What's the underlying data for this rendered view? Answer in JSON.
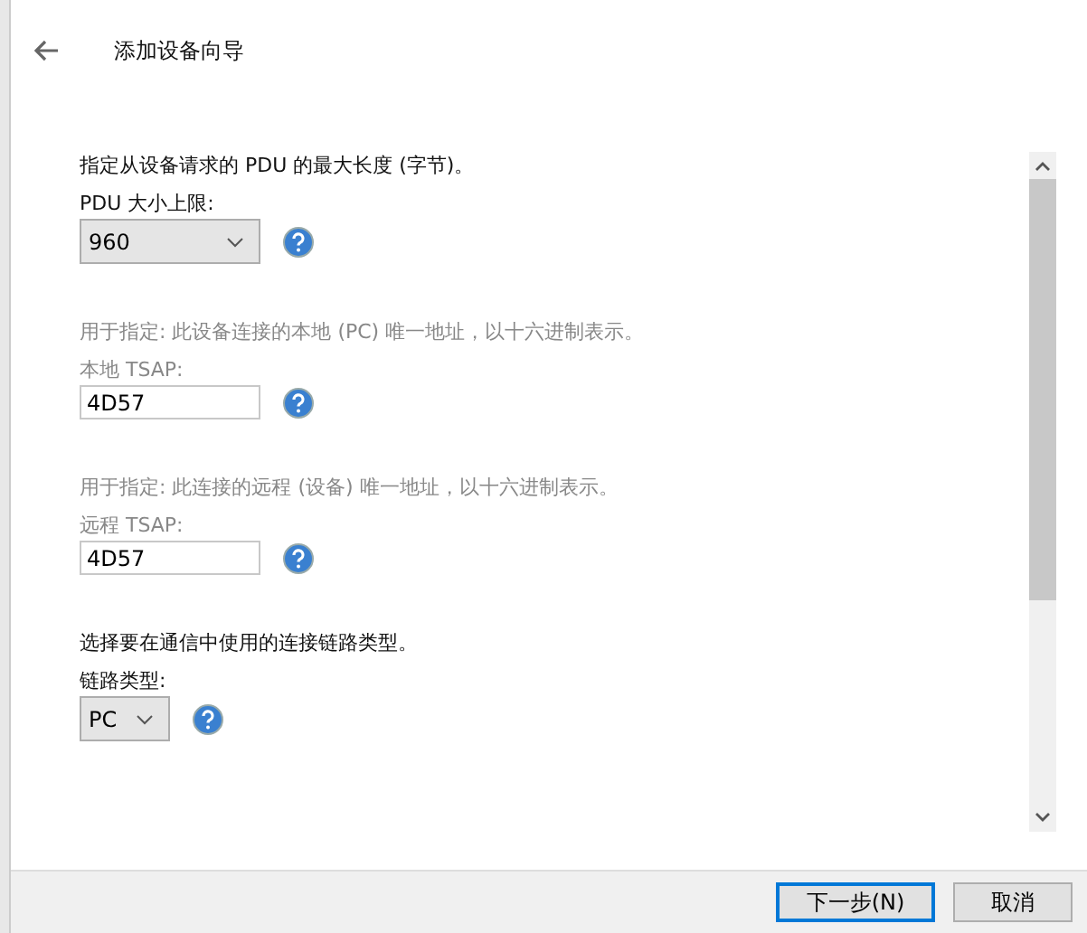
{
  "window": {
    "title": "添加设备向导"
  },
  "sections": [
    {
      "kind": "select",
      "disabled": false,
      "description": "指定从设备请求的  PDU 的最大长度 (字节)。",
      "label": "PDU 大小上限:",
      "value": "960",
      "narrow": false
    },
    {
      "kind": "input",
      "disabled": true,
      "description": "用于指定: 此设备连接的本地 (PC) 唯一地址，以十六进制表示。",
      "label": "本地 TSAP:",
      "value": "4D57"
    },
    {
      "kind": "input",
      "disabled": true,
      "description": "用于指定: 此连接的远程 (设备) 唯一地址，以十六进制表示。",
      "label": "远程 TSAP:",
      "value": "4D57"
    },
    {
      "kind": "select",
      "disabled": false,
      "description": "选择要在通信中使用的连接链路类型。",
      "label": "链路类型:",
      "value": "PC",
      "narrow": true
    }
  ],
  "buttons": [
    {
      "label": "下一步(N)",
      "default": true
    },
    {
      "label": "取消",
      "default": false
    }
  ]
}
